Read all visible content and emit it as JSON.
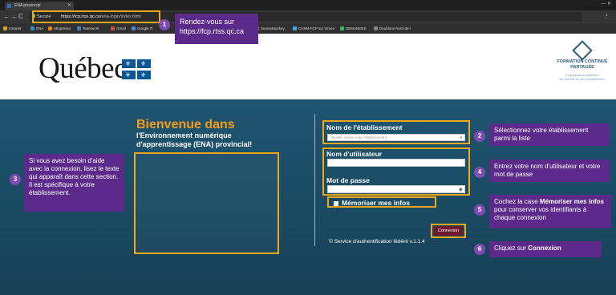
{
  "browser": {
    "tab_title": "ENA provincial",
    "secure_label": "Secure",
    "url_host": "https://fcp.rtss.qc.ca",
    "url_path": "/ena-login/index.html",
    "bookmarks": [
      {
        "label": "Intranet",
        "color": "#d6a21c"
      },
      {
        "label": "ENA",
        "color": "#2d8fd0"
      },
      {
        "label": "eExpresso",
        "color": "#e58a1a"
      },
      {
        "label": "Teamwork",
        "color": "#3a7fd0"
      },
      {
        "label": "Gmail",
        "color": "#d84a3a"
      },
      {
        "label": "Google Tr",
        "color": "#4a86d8"
      },
      {
        "label": "SurveyMonkey",
        "color": "#7a7a7a"
      },
      {
        "label": "CUSM-FCP sur Vimeo",
        "color": "#2db3e8"
      },
      {
        "label": "DEMANDES",
        "color": "#3ab05a"
      },
      {
        "label": "Doublons Nord-de-l",
        "color": "#888888"
      }
    ]
  },
  "header": {
    "logo_text": "Québec",
    "partner_title_1": "FORMATION CONTINUE",
    "partner_title_2": "PARTAGÉE",
    "partner_tagline_1": "La puissance collective",
    "partner_tagline_2": "au service de vos compétences"
  },
  "welcome": {
    "title": "Bienvenue dans",
    "subtitle_1": "l'Environnement numérique",
    "subtitle_2": "d'apprentissage (ENA) provincial!"
  },
  "form": {
    "establishment_label": "Nom de l'établissement",
    "establishment_placeholder": "Veuillez choisir votre établissement",
    "username_label": "Nom d'utilisateur",
    "password_label": "Mot de passe",
    "remember_label": "Mémoriser mes infos",
    "submit_label": "Connexion",
    "copyright": "© Service d'authentification fédéré v.1.1.4"
  },
  "callouts": [
    {
      "num": "1",
      "text": "Rendez-vous sur https://fcp.rtss.qc.ca"
    },
    {
      "num": "2",
      "text": "Sélectionnez votre établissement parmi la liste"
    },
    {
      "num": "3",
      "text": "Si vous avez besoin d'aide avec la connexion, lisez le texte qui apparaît dans cette section. Il est spécifique à votre établissement."
    },
    {
      "num": "4",
      "text": "Entrez votre nom d'utilisateur et votre mot de passe"
    },
    {
      "num": "5",
      "text_pre": "Cochez la case ",
      "text_bold": "Mémoriser mes infos",
      "text_post": " pour conserver vos identifiants à chaque connexion"
    },
    {
      "num": "6",
      "text_pre": "Cliquez sur ",
      "text_bold": "Connexion"
    }
  ],
  "colors": {
    "accent_orange": "#f59c1a",
    "callout_purple": "#5c2a8b",
    "button_maroon": "#6d1a2f",
    "quebec_blue": "#095797"
  }
}
